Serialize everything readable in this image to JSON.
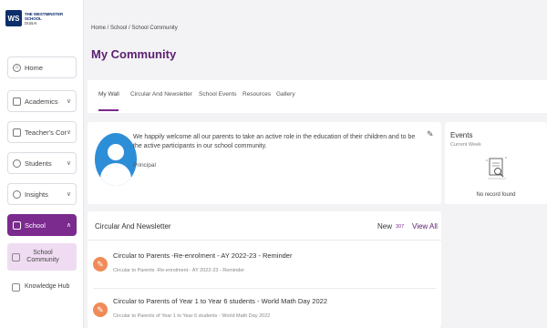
{
  "logo": {
    "badge": "WS",
    "line1": "THE WESTMINSTER SCHOOL",
    "line2": "DUBAI"
  },
  "sidebar": {
    "items": [
      {
        "label": "Home",
        "icon": "home-icon",
        "chevron": ""
      },
      {
        "label": "Academics",
        "icon": "book-icon",
        "chevron": "∨"
      },
      {
        "label": "Teacher's Corner",
        "icon": "teacher-icon",
        "chevron": "∨"
      },
      {
        "label": "Students",
        "icon": "students-icon",
        "chevron": "∨"
      },
      {
        "label": "Insights",
        "icon": "insights-icon",
        "chevron": "∨"
      },
      {
        "label": "School",
        "icon": "school-icon",
        "chevron": "∧"
      }
    ],
    "subitems": [
      {
        "label": "School Community",
        "icon": "community-icon"
      },
      {
        "label": "Knowledge Hub",
        "icon": "knowledge-icon"
      }
    ]
  },
  "breadcrumb": "Home / School / School Community",
  "page_title": "My Community",
  "tabs": [
    "My Wall",
    "Circular And Newsletter",
    "School Events",
    "Resources",
    "Gallery"
  ],
  "wall": {
    "message": "We happily welcome all our parents to take an active role in the education of their children and to be the active participants in our school community.",
    "signature": "Principal"
  },
  "events": {
    "title": "Events",
    "subtitle": "Current Week",
    "empty_text": "No record found"
  },
  "circulars": {
    "title": "Circular And Newsletter",
    "new_label": "New",
    "new_count": "307",
    "view_all": "View All",
    "items": [
      {
        "title": "Circular to Parents -Re-enrolment - AY 2022-23 - Reminder",
        "subtitle": "Circular to Parents -Re-enrolment - AY 2022-23 - Reminder"
      },
      {
        "title": "Circular to Parents of Year 1 to Year 6 students - World Math Day 2022",
        "subtitle": "Circular to Parents of Year 1 to Year 6 students - World Math Day 2022"
      }
    ]
  },
  "colors": {
    "accent": "#7b2a8e",
    "title": "#5b2070",
    "avatar": "#2d8ed8",
    "pin": "#f08a58",
    "selected_bg": "#f0dcf2"
  }
}
